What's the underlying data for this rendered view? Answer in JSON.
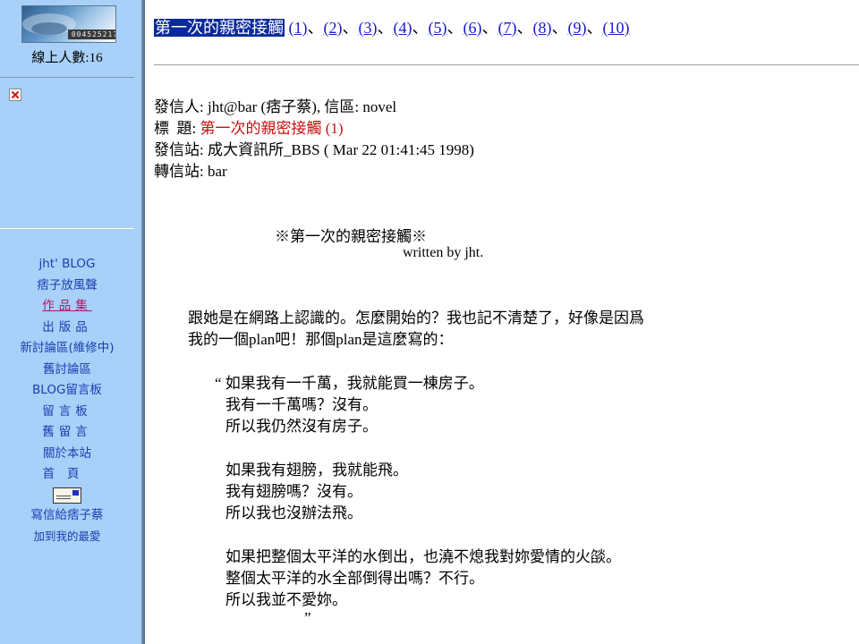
{
  "sidebar": {
    "counter": "004525217",
    "online_count": "線上人數:16",
    "nav": [
      {
        "label": "jht' BLOG"
      },
      {
        "label": "痞子放風聲"
      },
      {
        "label": "作品集"
      },
      {
        "label": "出版品"
      },
      {
        "label": "新討論區(維修中)"
      },
      {
        "label": "舊討論區"
      },
      {
        "label": "BLOG留言板"
      },
      {
        "label": "留言板"
      },
      {
        "label": "舊留言"
      },
      {
        "label": "關於本站"
      },
      {
        "label": "首頁"
      },
      {
        "label": "寫信給痞子蔡"
      },
      {
        "label": "加到我的最愛"
      }
    ]
  },
  "article": {
    "title": "第一次的親密接觸",
    "chapters": [
      "(1)",
      "(2)",
      "(3)",
      "(4)",
      "(5)",
      "(6)",
      "(7)",
      "(8)",
      "(9)",
      "(10)"
    ],
    "separator": "、",
    "headers": {
      "from_label": "發信人:",
      "from_value": "jht@bar (痞子蔡), 信區: novel",
      "subject_label": "標  題:",
      "subject_value": "第一次的親密接觸 (1)",
      "site_label": "發信站:",
      "site_value": "成大資訊所_BBS ( Mar 22 01:41:45 1998)",
      "relay_label": "轉信站:",
      "relay_value": "bar"
    },
    "poem_title": "※第一次的親密接觸※",
    "byline": "written by jht.",
    "body": {
      "p1_line1": "跟她是在網路上認識的。怎麼開始的？我也記不清楚了，好像是因爲",
      "p1_line2": "我的一個plan吧！那個plan是這麼寫的：",
      "q1_line1": "“ 如果我有一千萬，我就能買一棟房子。",
      "q1_line2": "我有一千萬嗎？沒有。",
      "q1_line3": "所以我仍然沒有房子。",
      "q2_line1": "如果我有翅膀，我就能飛。",
      "q2_line2": "我有翅膀嗎？沒有。",
      "q2_line3": "所以我也沒辦法飛。",
      "q3_line1": "如果把整個太平洋的水倒出，也澆不熄我對妳愛情的火燄。",
      "q3_line2": "整個太平洋的水全部倒得出嗎？不行。",
      "q3_line3": "所以我並不愛妳。",
      "close_quote": "”"
    }
  }
}
